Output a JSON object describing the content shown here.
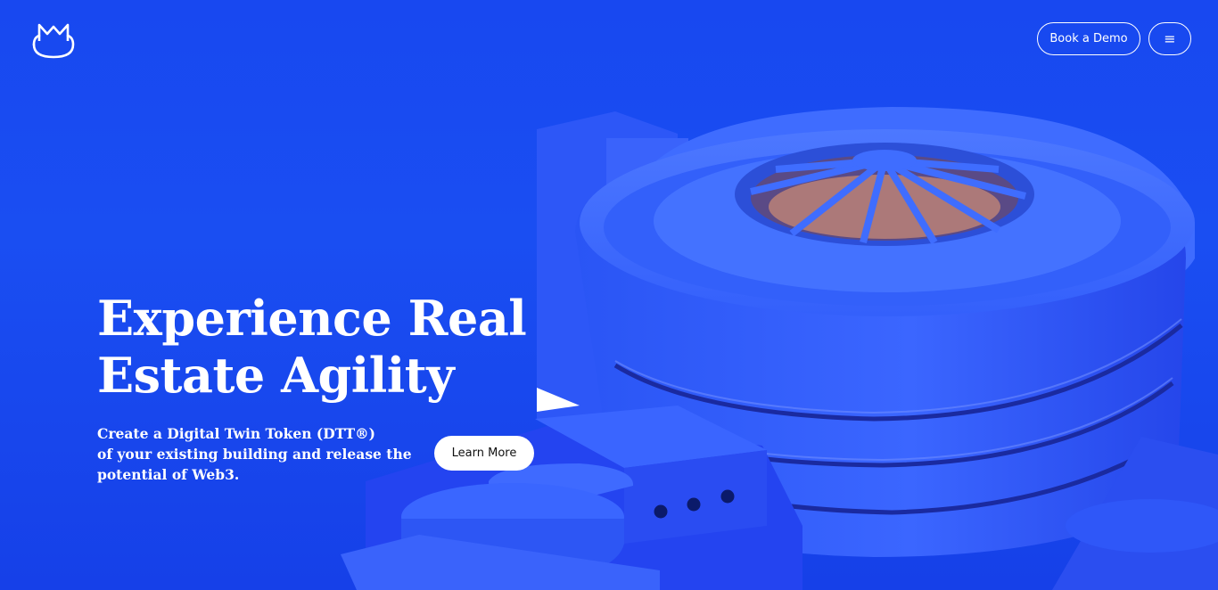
{
  "header": {
    "logo_icon": "m-cat-logo-icon",
    "book_demo_label": "Book a Demo",
    "menu_icon": "hamburger-menu-icon",
    "menu_glyph": "≡"
  },
  "hero": {
    "headline_line1": "Experience Real",
    "headline_line2": "Estate Agility",
    "subtext_line1": "Create a Digital Twin Token (DTT®)",
    "subtext_line2": "of your existing building and release the",
    "subtext_line3": "potential of Web3.",
    "cta_label": "Learn More",
    "illustration": "spiral-museum-building-illustration"
  },
  "colors": {
    "background": "#1848f0",
    "building_light": "#3d6bff",
    "building_dark": "#1f3fe8",
    "text": "#ffffff"
  }
}
